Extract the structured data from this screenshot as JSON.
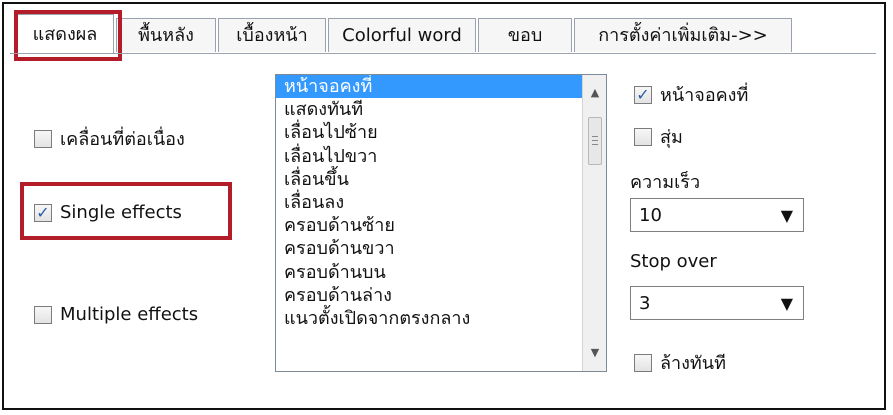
{
  "tabs": [
    "แสดงผล",
    "พื้นหลัง",
    "เบื้องหน้า",
    "Colorful word",
    "ขอบ",
    "การตั้งค่าเพิ่มเติม->>"
  ],
  "left_options": {
    "continuous_label": "เคลื่อนที่ต่อเนื่อง",
    "single_label": "Single effects",
    "multiple_label": "Multiple effects"
  },
  "effects_list": [
    "หน้าจอคงที่",
    "แสดงทันที",
    "เลื่อนไปซ้าย",
    "เลื่อนไปขวา",
    "เลื่อนขึ้น",
    "เลื่อนลง",
    "ครอบด้านซ้าย",
    "ครอบด้านขวา",
    "ครอบด้านบน",
    "ครอบด้านล่าง",
    "แนวตั้งเปิดจากตรงกลาง"
  ],
  "right_options": {
    "static_screen_label": "หน้าจอคงที่",
    "random_label": "สุ่ม",
    "speed_label": "ความเร็ว",
    "speed_value": "10",
    "stop_over_label": "Stop over",
    "stop_over_value": "3",
    "clear_label": "ล้างทันที"
  }
}
